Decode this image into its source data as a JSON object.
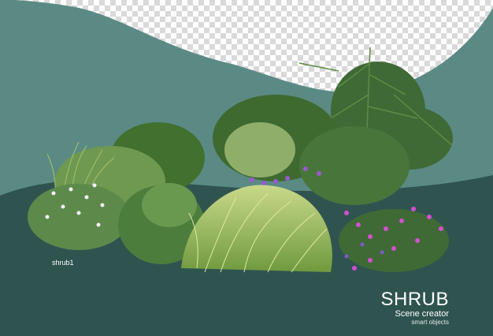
{
  "scene": {
    "object_label": "shrub1",
    "brand_title": "SHRUB",
    "brand_subtitle": "Scene creator",
    "brand_tagline": "smart objects"
  },
  "colors": {
    "upper_band": "#5b8a84",
    "lower_band": "#2f5450",
    "checker_light": "#ffffff",
    "checker_dark": "#d9d9d9",
    "flower_purple": "#9b59d0",
    "flower_magenta": "#d24fd0",
    "flower_white": "#f2f0ff"
  }
}
